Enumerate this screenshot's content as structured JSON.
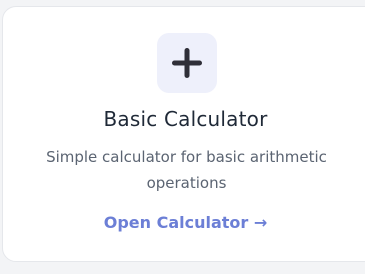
{
  "card": {
    "icon": "plus-icon",
    "title": "Basic Calculator",
    "description": "Simple calculator for basic arithmetic operations",
    "link_label": "Open Calculator →"
  },
  "colors": {
    "icon_bg": "#eef0fb",
    "icon_fg": "#2f2f38",
    "link": "#6c7fd6",
    "title": "#1f2937",
    "description": "#5b6472"
  }
}
